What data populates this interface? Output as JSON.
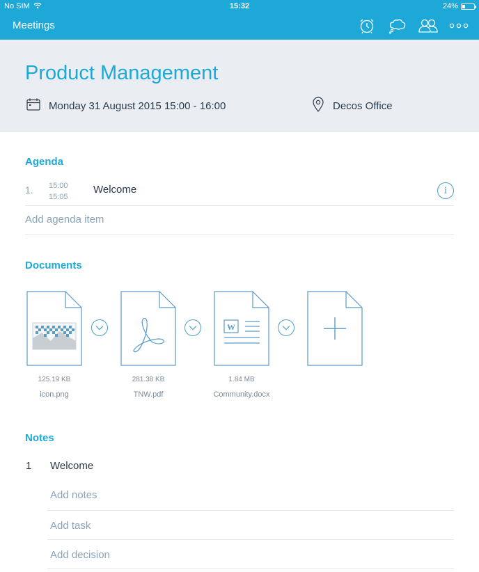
{
  "status_bar": {
    "carrier": "No SIM",
    "time": "15:32",
    "battery": "24%",
    "battery_level": 0.24
  },
  "nav": {
    "title": "Meetings",
    "icons": [
      "alarm-clock-icon",
      "chat-bubble-icon",
      "participants-icon",
      "more-icon"
    ],
    "accent_color": "#1ea8d8"
  },
  "meeting": {
    "title": "Product Management",
    "datetime": "Monday 31 August 2015 15:00 - 16:00",
    "location": "Decos Office"
  },
  "agenda": {
    "heading": "Agenda",
    "items": [
      {
        "number": "1.",
        "start": "15:00",
        "end": "15:05",
        "label": "Welcome"
      }
    ],
    "add_label": "Add agenda item"
  },
  "documents": {
    "heading": "Documents",
    "files": [
      {
        "name": "icon.png",
        "size": "125.19 KB",
        "type": "image"
      },
      {
        "name": "TNW.pdf",
        "size": "281.38 KB",
        "type": "pdf"
      },
      {
        "name": "Community.docx",
        "size": "1.84 MB",
        "type": "word"
      }
    ],
    "word_badge": "W"
  },
  "notes": {
    "heading": "Notes",
    "items": [
      {
        "number": "1",
        "title": "Welcome"
      }
    ],
    "add_notes": "Add notes",
    "add_task": "Add task",
    "add_decision": "Add decision"
  }
}
